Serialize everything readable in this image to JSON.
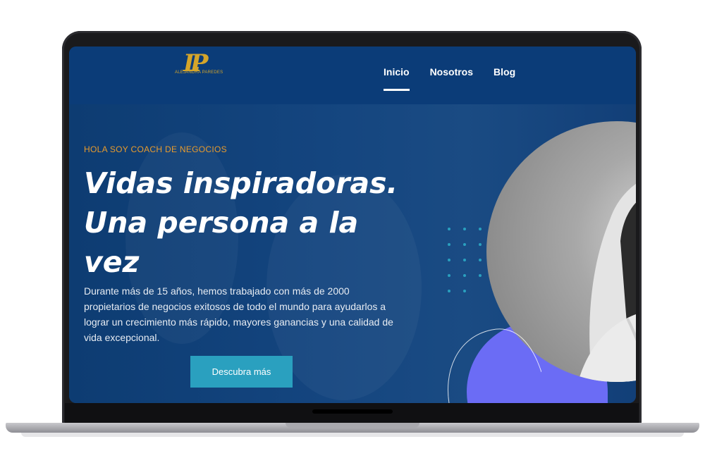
{
  "header": {
    "logo_letters": "LP",
    "logo_name": "ALEJANDRA PAREDES",
    "nav": [
      {
        "label": "Inicio",
        "active": true
      },
      {
        "label": "Nosotros",
        "active": false
      },
      {
        "label": "Blog",
        "active": false
      }
    ]
  },
  "hero": {
    "eyebrow": "HOLA SOY COACH DE NEGOCIOS",
    "title_line1": "Vidas inspiradoras.",
    "title_line2": "Una persona a la",
    "title_line3": "vez",
    "description": "Durante más de 15 años, hemos trabajado con más de 2000 propietarios de negocios exitosos de todo el mundo para ayudarlos a lograr un crecimiento más rápido, mayores ganancias y una calidad de vida excepcional.",
    "cta_label": "Descubra más"
  },
  "colors": {
    "header_bg": "#0b3c78",
    "accent_orange": "#e89b2d",
    "cta_bg": "#2aa0bf",
    "blob_purple": "#6b6cf5",
    "logo_gold": "#d4a52a"
  }
}
